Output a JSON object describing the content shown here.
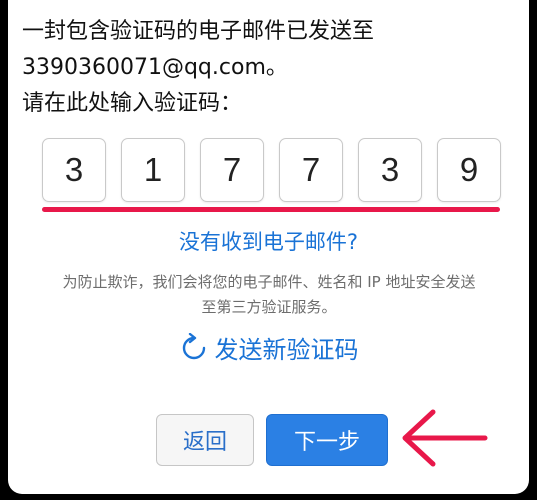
{
  "message": {
    "line1": "一封包含验证码的电子邮件已发送至",
    "line2": "3390360071@qq.com。",
    "line3": "请在此处输入验证码："
  },
  "code_digits": [
    "3",
    "1",
    "7",
    "7",
    "3",
    "9"
  ],
  "links": {
    "no_email": "没有收到电子邮件?"
  },
  "notice": {
    "line1": "为防止欺诈，我们会将您的电子邮件、姓名和 IP 地址安全发送",
    "line2": "至第三方验证服务。"
  },
  "resend": {
    "label": "发送新验证码",
    "icon": "refresh-icon"
  },
  "buttons": {
    "back": "返回",
    "next": "下一步"
  },
  "colors": {
    "link_blue": "#1a73d6",
    "primary_button": "#2b80e4",
    "annotation_red": "#e8184a"
  }
}
